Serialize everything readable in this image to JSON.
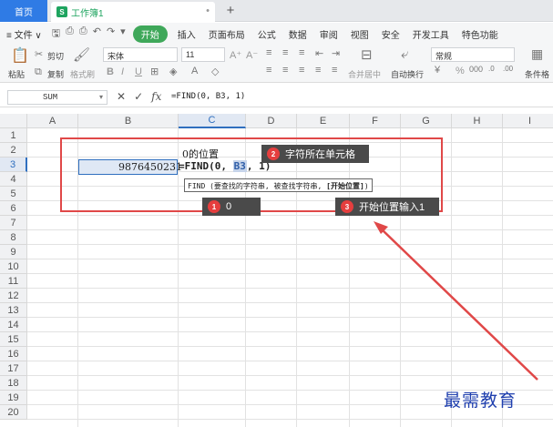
{
  "tabs": {
    "home": "首页",
    "document": "工作簿1",
    "doc_icon_letter": "S",
    "close_glyph": "•",
    "add_glyph": "+"
  },
  "menu": {
    "hamburger": "≡",
    "file": "文件",
    "file_arrow": "∨",
    "items": [
      "开始",
      "插入",
      "页面布局",
      "公式",
      "数据",
      "审阅",
      "视图",
      "安全",
      "开发工具",
      "特色功能"
    ],
    "active_index": 0
  },
  "ribbon": {
    "paste": "粘贴",
    "cut": "剪切",
    "copy": "复制",
    "format_painter": "格式刷",
    "font_name": "宋体",
    "font_size": "11",
    "bold": "B",
    "italic": "I",
    "underline": "U",
    "grow_font": "A⁺",
    "shrink_font": "A⁻",
    "merge_center": "合并居中",
    "wrap_text": "自动换行",
    "number_format": "常规",
    "percent": "%",
    "conditional_format": "条件格"
  },
  "formula_bar": {
    "name_box": "SUM",
    "cancel": "✕",
    "confirm": "✓",
    "fx": "fx",
    "formula": "=FIND(0, B3, 1)"
  },
  "grid": {
    "columns": [
      "A",
      "B",
      "C",
      "D",
      "E",
      "F",
      "G",
      "H",
      "I"
    ],
    "selected_column": "C",
    "rows": [
      "1",
      "2",
      "3",
      "4",
      "5",
      "6",
      "7",
      "8",
      "9",
      "10",
      "11",
      "12",
      "13",
      "14",
      "15",
      "16",
      "17",
      "18",
      "19",
      "20"
    ],
    "selected_row": "3",
    "c2_text": "0的位置",
    "b3_value": "9876450231",
    "c3_edit": {
      "prefix": "=FIND(0, ",
      "ref": "B3",
      "suffix": ", 1)"
    },
    "tooltip": {
      "text": "FIND (要查找的字符串, 被查找字符串, ",
      "bold": "[开始位置]",
      "close": ")"
    }
  },
  "callouts": [
    {
      "number": "1",
      "text": "0"
    },
    {
      "number": "2",
      "text": "字符所在单元格"
    },
    {
      "number": "3",
      "text": "开始位置输入1"
    }
  ],
  "watermark": "最需教育",
  "colors": {
    "accent_green": "#3fa85a",
    "tab_blue": "#2f7be5",
    "highlight_red": "#e04848",
    "callout_bg": "#4a4a4a",
    "badge_red": "#e53e3e",
    "watermark_blue": "#1f3fae"
  }
}
